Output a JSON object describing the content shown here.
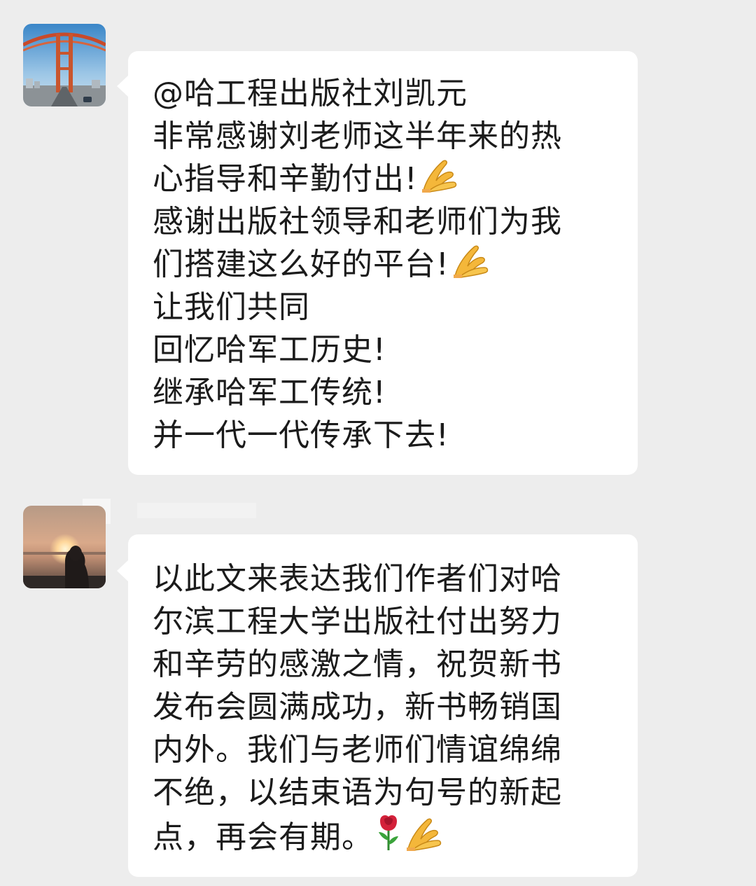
{
  "messages": [
    {
      "sender_avatar": "bridge-photo-avatar",
      "lines": [
        "@哈工程出版社刘凯元",
        "非常感谢刘老师这半年来的热",
        "心指导和辛勤付出!",
        "感谢出版社领导和老师们为我",
        "们搭建这么好的平台!",
        "让我们共同",
        "回忆哈军工历史!",
        "继承哈军工传统!",
        "并一代一代传承下去!"
      ],
      "emoji_after_lines": {
        "2": [
          "folded-hands-icon"
        ],
        "4": [
          "folded-hands-icon"
        ]
      }
    },
    {
      "sender_avatar": "sunset-photo-avatar",
      "lines": [
        "以此文来表达我们作者们对哈",
        "尔滨工程大学出版社付出努力",
        "和辛劳的感激之情，祝贺新书",
        "发布会圆满成功，新书畅销国",
        "内外。我们与老师们情谊绵绵",
        "不绝，以结束语为句号的新起",
        "点，再会有期。"
      ],
      "emoji_after_lines": {
        "6": [
          "rose-icon",
          "folded-hands-icon"
        ]
      }
    }
  ],
  "colors": {
    "background": "#ededed",
    "bubble": "#ffffff",
    "text": "#1b1b1b"
  }
}
